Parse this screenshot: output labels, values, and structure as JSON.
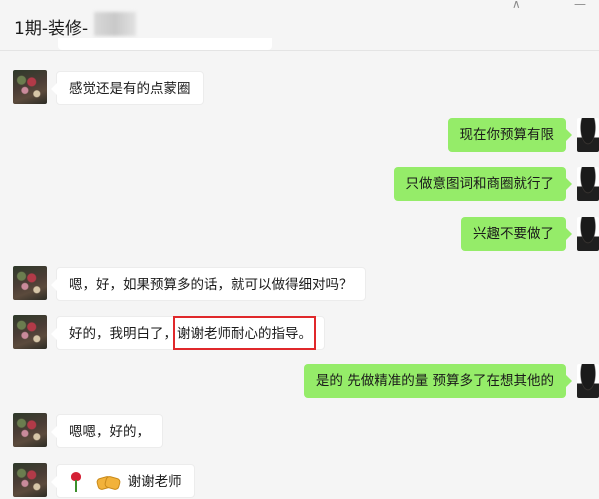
{
  "header": {
    "title": "1期-装修-"
  },
  "window": {
    "pin_glyph": "⊼",
    "minimize_glyph": "—"
  },
  "messages": [
    {
      "side": "left",
      "text": "感觉还是有的点蒙圈"
    },
    {
      "side": "right",
      "text": "现在你预算有限"
    },
    {
      "side": "right",
      "text": "只做意图词和商圈就行了"
    },
    {
      "side": "right",
      "text": "兴趣不要做了"
    },
    {
      "side": "left",
      "text": "嗯，好，如果预算多的话，就可以做得细对吗？"
    },
    {
      "side": "left",
      "text": "好的，我明白了，谢谢老师耐心的指导。"
    },
    {
      "side": "right",
      "text": "是的  先做精准的量   预算多了在想其他的"
    },
    {
      "side": "left",
      "text": "嗯嗯，好的，"
    },
    {
      "side": "left",
      "text": "谢谢老师",
      "emojis": [
        "rose-icon",
        "handshake-icon"
      ]
    }
  ],
  "colors": {
    "sent_bubble": "#95ec69",
    "received_bubble": "#ffffff",
    "highlight_box": "#e0282b"
  }
}
